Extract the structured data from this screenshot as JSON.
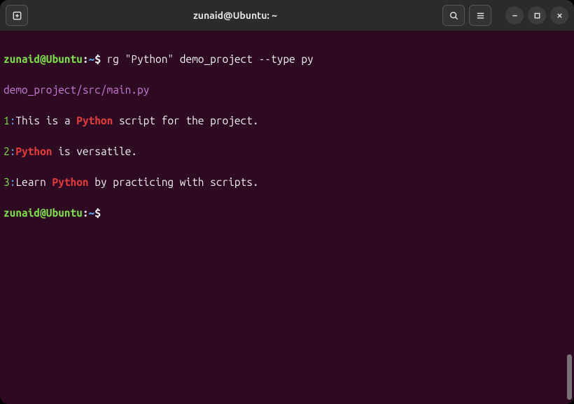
{
  "titlebar": {
    "title": "zunaid@Ubuntu: ~"
  },
  "prompt": {
    "user_host": "zunaid@Ubuntu",
    "separator1": ":",
    "cwd": "~",
    "symbol": "$"
  },
  "command": "rg \"Python\" demo_project --type py",
  "result_file": "demo_project/src/main.py",
  "matches": [
    {
      "num": "1",
      "pre": "This is a ",
      "hl": "Python",
      "post": " script for the project."
    },
    {
      "num": "2",
      "pre": "",
      "hl": "Python",
      "post": " is versatile."
    },
    {
      "num": "3",
      "pre": "Learn ",
      "hl": "Python",
      "post": " by practicing with scripts."
    }
  ]
}
